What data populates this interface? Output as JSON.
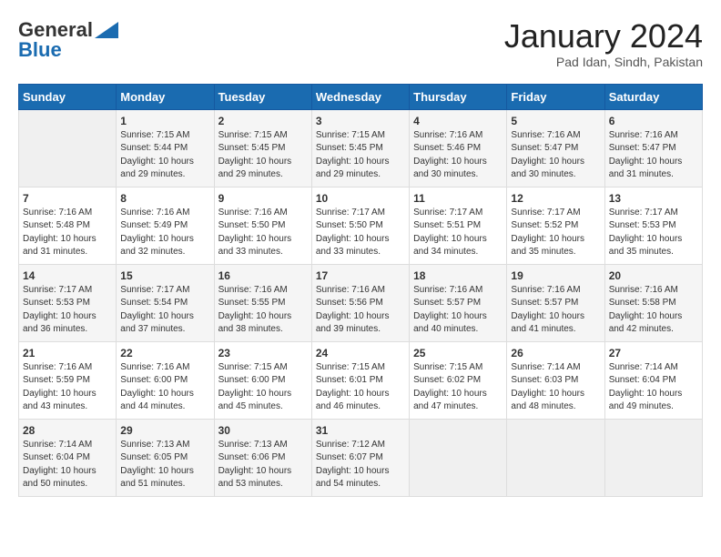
{
  "logo": {
    "line1": "General",
    "line2": "Blue"
  },
  "title": "January 2024",
  "subtitle": "Pad Idan, Sindh, Pakistan",
  "weekdays": [
    "Sunday",
    "Monday",
    "Tuesday",
    "Wednesday",
    "Thursday",
    "Friday",
    "Saturday"
  ],
  "weeks": [
    [
      {
        "day": null
      },
      {
        "day": 1,
        "sunrise": "7:15 AM",
        "sunset": "5:44 PM",
        "daylight": "10 hours and 29 minutes."
      },
      {
        "day": 2,
        "sunrise": "7:15 AM",
        "sunset": "5:45 PM",
        "daylight": "10 hours and 29 minutes."
      },
      {
        "day": 3,
        "sunrise": "7:15 AM",
        "sunset": "5:45 PM",
        "daylight": "10 hours and 29 minutes."
      },
      {
        "day": 4,
        "sunrise": "7:16 AM",
        "sunset": "5:46 PM",
        "daylight": "10 hours and 30 minutes."
      },
      {
        "day": 5,
        "sunrise": "7:16 AM",
        "sunset": "5:47 PM",
        "daylight": "10 hours and 30 minutes."
      },
      {
        "day": 6,
        "sunrise": "7:16 AM",
        "sunset": "5:47 PM",
        "daylight": "10 hours and 31 minutes."
      }
    ],
    [
      {
        "day": 7,
        "sunrise": "7:16 AM",
        "sunset": "5:48 PM",
        "daylight": "10 hours and 31 minutes."
      },
      {
        "day": 8,
        "sunrise": "7:16 AM",
        "sunset": "5:49 PM",
        "daylight": "10 hours and 32 minutes."
      },
      {
        "day": 9,
        "sunrise": "7:16 AM",
        "sunset": "5:50 PM",
        "daylight": "10 hours and 33 minutes."
      },
      {
        "day": 10,
        "sunrise": "7:17 AM",
        "sunset": "5:50 PM",
        "daylight": "10 hours and 33 minutes."
      },
      {
        "day": 11,
        "sunrise": "7:17 AM",
        "sunset": "5:51 PM",
        "daylight": "10 hours and 34 minutes."
      },
      {
        "day": 12,
        "sunrise": "7:17 AM",
        "sunset": "5:52 PM",
        "daylight": "10 hours and 35 minutes."
      },
      {
        "day": 13,
        "sunrise": "7:17 AM",
        "sunset": "5:53 PM",
        "daylight": "10 hours and 35 minutes."
      }
    ],
    [
      {
        "day": 14,
        "sunrise": "7:17 AM",
        "sunset": "5:53 PM",
        "daylight": "10 hours and 36 minutes."
      },
      {
        "day": 15,
        "sunrise": "7:17 AM",
        "sunset": "5:54 PM",
        "daylight": "10 hours and 37 minutes."
      },
      {
        "day": 16,
        "sunrise": "7:16 AM",
        "sunset": "5:55 PM",
        "daylight": "10 hours and 38 minutes."
      },
      {
        "day": 17,
        "sunrise": "7:16 AM",
        "sunset": "5:56 PM",
        "daylight": "10 hours and 39 minutes."
      },
      {
        "day": 18,
        "sunrise": "7:16 AM",
        "sunset": "5:57 PM",
        "daylight": "10 hours and 40 minutes."
      },
      {
        "day": 19,
        "sunrise": "7:16 AM",
        "sunset": "5:57 PM",
        "daylight": "10 hours and 41 minutes."
      },
      {
        "day": 20,
        "sunrise": "7:16 AM",
        "sunset": "5:58 PM",
        "daylight": "10 hours and 42 minutes."
      }
    ],
    [
      {
        "day": 21,
        "sunrise": "7:16 AM",
        "sunset": "5:59 PM",
        "daylight": "10 hours and 43 minutes."
      },
      {
        "day": 22,
        "sunrise": "7:16 AM",
        "sunset": "6:00 PM",
        "daylight": "10 hours and 44 minutes."
      },
      {
        "day": 23,
        "sunrise": "7:15 AM",
        "sunset": "6:00 PM",
        "daylight": "10 hours and 45 minutes."
      },
      {
        "day": 24,
        "sunrise": "7:15 AM",
        "sunset": "6:01 PM",
        "daylight": "10 hours and 46 minutes."
      },
      {
        "day": 25,
        "sunrise": "7:15 AM",
        "sunset": "6:02 PM",
        "daylight": "10 hours and 47 minutes."
      },
      {
        "day": 26,
        "sunrise": "7:14 AM",
        "sunset": "6:03 PM",
        "daylight": "10 hours and 48 minutes."
      },
      {
        "day": 27,
        "sunrise": "7:14 AM",
        "sunset": "6:04 PM",
        "daylight": "10 hours and 49 minutes."
      }
    ],
    [
      {
        "day": 28,
        "sunrise": "7:14 AM",
        "sunset": "6:04 PM",
        "daylight": "10 hours and 50 minutes."
      },
      {
        "day": 29,
        "sunrise": "7:13 AM",
        "sunset": "6:05 PM",
        "daylight": "10 hours and 51 minutes."
      },
      {
        "day": 30,
        "sunrise": "7:13 AM",
        "sunset": "6:06 PM",
        "daylight": "10 hours and 53 minutes."
      },
      {
        "day": 31,
        "sunrise": "7:12 AM",
        "sunset": "6:07 PM",
        "daylight": "10 hours and 54 minutes."
      },
      {
        "day": null
      },
      {
        "day": null
      },
      {
        "day": null
      }
    ]
  ]
}
